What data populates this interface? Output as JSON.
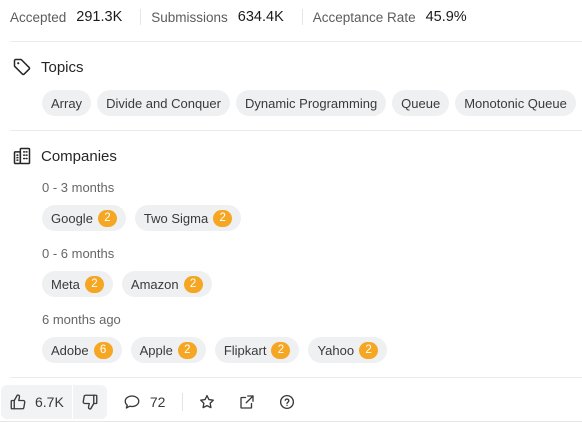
{
  "stats": [
    {
      "label": "Accepted",
      "value": "291.3K"
    },
    {
      "label": "Submissions",
      "value": "634.4K"
    },
    {
      "label": "Acceptance Rate",
      "value": "45.9%"
    }
  ],
  "topics": {
    "title": "Topics",
    "tags": [
      "Array",
      "Divide and Conquer",
      "Dynamic Programming",
      "Queue",
      "Monotonic Queue"
    ]
  },
  "companies": {
    "title": "Companies",
    "periods": [
      {
        "label": "0 - 3 months",
        "items": [
          {
            "name": "Google",
            "count": "2"
          },
          {
            "name": "Two Sigma",
            "count": "2"
          }
        ]
      },
      {
        "label": "0 - 6 months",
        "items": [
          {
            "name": "Meta",
            "count": "2"
          },
          {
            "name": "Amazon",
            "count": "2"
          }
        ]
      },
      {
        "label": "6 months ago",
        "items": [
          {
            "name": "Adobe",
            "count": "6"
          },
          {
            "name": "Apple",
            "count": "2"
          },
          {
            "name": "Flipkart",
            "count": "2"
          },
          {
            "name": "Yahoo",
            "count": "2"
          }
        ]
      }
    ]
  },
  "footer": {
    "likes": "6.7K",
    "comments": "72"
  },
  "colors": {
    "badge": "#f5a623",
    "chip_bg": "#eff0f1"
  }
}
